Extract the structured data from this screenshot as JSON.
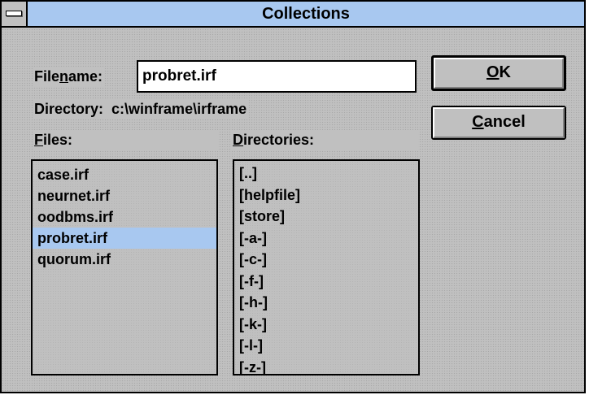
{
  "window": {
    "title": "Collections"
  },
  "filename": {
    "label_pre": "File",
    "label_mnemonic": "n",
    "label_post": "ame:",
    "value": "probret.irf"
  },
  "directory": {
    "label": "Directory:",
    "path": "c:\\winframe\\irframe"
  },
  "files": {
    "label_mnemonic": "F",
    "label_post": "iles:",
    "items": [
      "case.irf",
      "neurnet.irf",
      "oodbms.irf",
      "probret.irf",
      "quorum.irf"
    ],
    "selected": "probret.irf"
  },
  "directories": {
    "label_mnemonic": "D",
    "label_post": "irectories:",
    "items": [
      "[..]",
      "[helpfile]",
      "[store]",
      "[-a-]",
      "[-c-]",
      "[-f-]",
      "[-h-]",
      "[-k-]",
      "[-l-]",
      "[-z-]"
    ]
  },
  "buttons": {
    "ok_mnemonic": "O",
    "ok_post": "K",
    "cancel_mnemonic": "C",
    "cancel_post": "ancel"
  },
  "colors": {
    "titlebar": "#a8c8f0",
    "face": "#c0c0c0",
    "selection": "#a8c8f0"
  }
}
